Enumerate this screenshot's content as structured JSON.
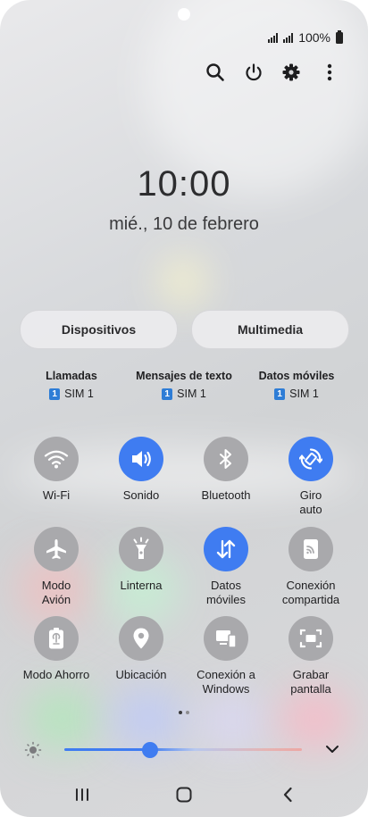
{
  "status_bar": {
    "battery": "100%",
    "icons": [
      "signal-sim1-icon",
      "signal-sim2-icon",
      "battery-icon"
    ]
  },
  "top_actions": [
    "search-icon",
    "power-icon",
    "settings-gear-icon",
    "more-vert-icon"
  ],
  "lock_clock": {
    "time": "10:00",
    "date": "mié., 10 de febrero"
  },
  "pills": {
    "devices": "Dispositivos",
    "media": "Multimedia"
  },
  "sim_prefs": [
    {
      "title": "Llamadas",
      "sim": "SIM 1",
      "badge": "1"
    },
    {
      "title": "Mensajes de texto",
      "sim": "SIM 1",
      "badge": "1"
    },
    {
      "title": "Datos móviles",
      "sim": "SIM 1",
      "badge": "1"
    }
  ],
  "tiles": [
    {
      "label": "Wi-Fi",
      "icon": "wifi-icon",
      "on": false
    },
    {
      "label": "Sonido",
      "icon": "volume-icon",
      "on": true
    },
    {
      "label": "Bluetooth",
      "icon": "bluetooth-icon",
      "on": false
    },
    {
      "label": "Giro\nauto",
      "icon": "auto-rotate-icon",
      "on": true
    },
    {
      "label": "Modo\nAvión",
      "icon": "airplane-icon",
      "on": false
    },
    {
      "label": "Linterna",
      "icon": "flashlight-icon",
      "on": false
    },
    {
      "label": "Datos\nmóviles",
      "icon": "mobile-data-icon",
      "on": true
    },
    {
      "label": "Conexión\ncompartida",
      "icon": "hotspot-icon",
      "on": false
    },
    {
      "label": "Modo Ahorro",
      "icon": "power-saving-icon",
      "on": false
    },
    {
      "label": "Ubicación",
      "icon": "location-icon",
      "on": false
    },
    {
      "label": "Conexión a\nWindows",
      "icon": "link-to-windows-icon",
      "on": false
    },
    {
      "label": "Grabar\npantalla",
      "icon": "screen-record-icon",
      "on": false
    }
  ],
  "pager": {
    "pages": 2,
    "current": 1
  },
  "brightness": {
    "level": 0.36
  },
  "nav": [
    "recents-icon",
    "home-icon",
    "back-icon"
  ],
  "colors": {
    "accent": "#3f7cf1",
    "tile_off": "#a9a9ac",
    "sim_badge": "#2e7dd6"
  }
}
